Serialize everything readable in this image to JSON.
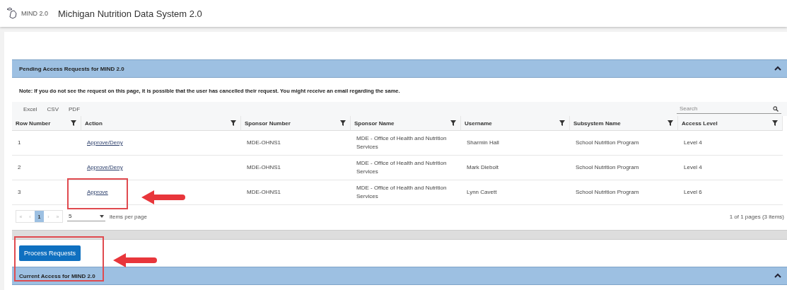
{
  "header": {
    "logo_text": "MIND 2.0",
    "title": "Michigan Nutrition Data System 2.0"
  },
  "pending_panel": {
    "title": "Pending Access Requests for MIND 2.0",
    "expanded": true,
    "note": "Note: If you do not see the request on this page, it is possible that the user has cancelled their request. You might receive an email regarding the same.",
    "export_buttons": [
      "Excel",
      "CSV",
      "PDF"
    ],
    "search": {
      "placeholder": "Search"
    },
    "columns": [
      "Row Number",
      "Action",
      "Sponsor Number",
      "Sponsor Name",
      "Username",
      "Subsystem Name",
      "Access Level"
    ],
    "rows": [
      {
        "row_number": "1",
        "action": "Approve/Deny",
        "sponsor_number": "MDE-OHNS1",
        "sponsor_name": "MDE - Office of Health and Nutrition Services",
        "username": "Sharmin Hall",
        "subsystem": "School Nutrition Program",
        "access_level": "Level 4",
        "highlighted": false
      },
      {
        "row_number": "2",
        "action": "Approve/Deny",
        "sponsor_number": "MDE-OHNS1",
        "sponsor_name": "MDE - Office of Health and Nutrition Services",
        "username": "Mark Diebolt",
        "subsystem": "School Nutrition Program",
        "access_level": "Level 4",
        "highlighted": false
      },
      {
        "row_number": "3",
        "action": "Approve",
        "sponsor_number": "MDE-OHNS1",
        "sponsor_name": "MDE - Office of Health and Nutrition Services",
        "username": "Lynn Cavett",
        "subsystem": "School Nutrition Program",
        "access_level": "Level 6",
        "highlighted": true
      }
    ],
    "pager": {
      "first": "«",
      "previous": "‹",
      "next": "›",
      "last": "»",
      "pages": [
        {
          "label": "1",
          "selected": true
        }
      ],
      "page_size": "5",
      "page_size_label": "items per page",
      "summary": "1 of 1 pages (3 items)"
    }
  },
  "process_button": {
    "label": "Process Requests",
    "highlighted": true
  },
  "current_panel": {
    "title": "Current Access for MIND 2.0",
    "expanded": true
  }
}
